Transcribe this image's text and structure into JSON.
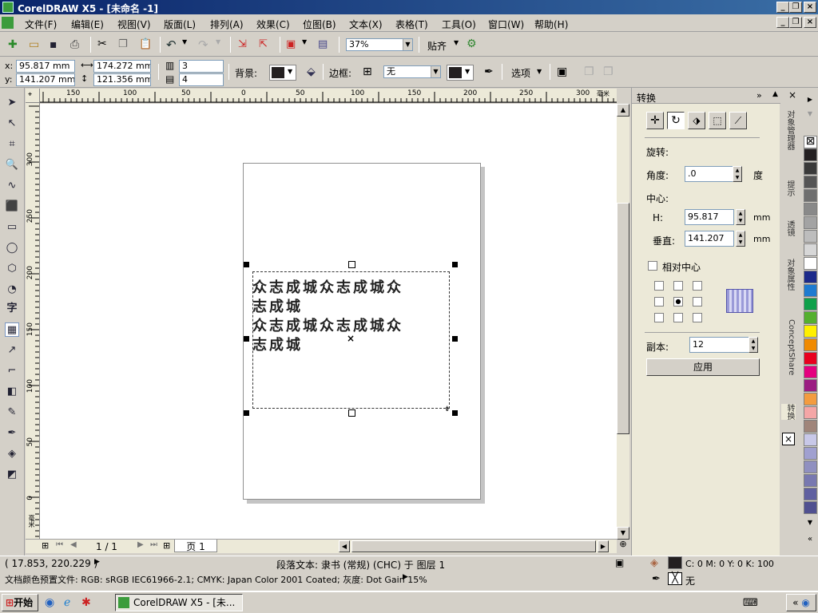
{
  "title": "CorelDRAW X5 - [未命名 -1]",
  "menu": [
    "文件(F)",
    "编辑(E)",
    "视图(V)",
    "版面(L)",
    "排列(A)",
    "效果(C)",
    "位图(B)",
    "文本(X)",
    "表格(T)",
    "工具(O)",
    "窗口(W)",
    "帮助(H)"
  ],
  "standard_toolbar": {
    "zoom": "37%",
    "snap_label": "贴齐"
  },
  "property_bar": {
    "x": "95.817 mm",
    "y": "141.207 mm",
    "w": "174.272 mm",
    "h": "121.356 mm",
    "x_label": "x:",
    "y_label": "y:",
    "columns": "3",
    "rows": "4",
    "bg_label": "背景:",
    "border_label": "边框:",
    "border_value": "无",
    "options_label": "选项"
  },
  "ruler": {
    "h_ticks": [
      "150",
      "100",
      "50",
      "0",
      "50",
      "100",
      "150",
      "200",
      "250",
      "300"
    ],
    "h_unit": "毫米",
    "v_ticks": [
      "300",
      "250",
      "200",
      "150",
      "100",
      "50",
      "0"
    ],
    "v_unit": "毫米"
  },
  "canvas": {
    "lines": [
      "众志成城众志成城众",
      "志成城",
      "众志成城众志成城众",
      "志成城"
    ]
  },
  "page_nav": {
    "pages": "1 / 1",
    "tab": "页 1"
  },
  "docker": {
    "title": "转换",
    "rotate_label": "旋转:",
    "angle_label": "角度:",
    "angle_value": ".0",
    "angle_unit": "度",
    "center_label": "中心:",
    "h_label": "H:",
    "h_value": "95.817",
    "h_unit": "mm",
    "v_label": "垂直:",
    "v_value": "141.207",
    "v_unit": "mm",
    "relative_label": "相对中心",
    "copies_label": "副本:",
    "copies_value": "12",
    "apply_label": "应用",
    "tabs": [
      "对象管理器",
      "提示",
      "透镜",
      "对象属性",
      "ConceptShare",
      "转换"
    ]
  },
  "palette_colors": [
    "#231f20",
    "#3a3a3a",
    "#555555",
    "#6f6f6f",
    "#898989",
    "#a3a3a3",
    "#bdbdbd",
    "#d7d7d7",
    "#ffffff",
    "#1c2a8a",
    "#1e7bd0",
    "#0fa04a",
    "#55b02f",
    "#fff000",
    "#f08a00",
    "#e8001e",
    "#e4007f",
    "#9b1d82",
    "#f39c40",
    "#f4a6a6",
    "#a0857a",
    "#c8c8e8",
    "#a0a0d0",
    "#9090c0",
    "#7878b0",
    "#6060a0",
    "#505090"
  ],
  "status": {
    "coords": "( 17.853, 220.229 )",
    "info": "段落文本: 隶书 (常规) (CHC) 于 图层 1",
    "fill_info": "C: 0 M: 0 Y: 0 K: 100",
    "outline_info": "无",
    "color_profile": "文档颜色预置文件: RGB: sRGB IEC61966-2.1; CMYK: Japan Color 2001 Coated; 灰度: Dot Gain 15%"
  },
  "taskbar": {
    "start": "开始",
    "task": "CorelDRAW X5 - [未..."
  }
}
